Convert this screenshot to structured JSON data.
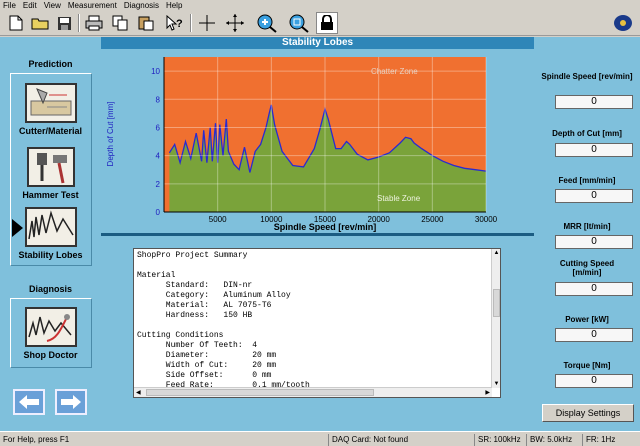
{
  "menu": [
    "File",
    "Edit",
    "View",
    "Measurement",
    "Diagnosis",
    "Help"
  ],
  "toolbar_icons": [
    "new-file-icon",
    "open-folder-icon",
    "save-icon",
    "print-icon",
    "copy-icon",
    "paste-icon",
    "context-help-icon",
    "crosshair-icon",
    "move-crosshair-icon",
    "zoom-in-icon",
    "zoom-fit-icon",
    "lock-icon",
    "app-logo-icon"
  ],
  "left": {
    "prediction_title": "Prediction",
    "cutter_label": "Cutter/Material",
    "hammer_label": "Hammer Test",
    "stability_label": "Stability Lobes",
    "diagnosis_title": "Diagnosis",
    "doctor_label": "Shop Doctor"
  },
  "chart": {
    "panel_title": "Stability Lobes",
    "chatter_label": "Chatter Zone",
    "stable_label": "Stable Zone"
  },
  "chart_data": {
    "type": "area",
    "title": "Stability Lobes",
    "xlabel": "Spindle Speed [rev/min]",
    "ylabel": "Depth of Cut [mm]",
    "xlim": [
      0,
      30000
    ],
    "ylim": [
      0,
      11
    ],
    "x_ticks": [
      5000,
      10000,
      15000,
      20000,
      25000,
      30000
    ],
    "y_ticks": [
      0,
      2,
      4,
      6,
      8,
      10
    ],
    "colors": {
      "chatter": "#f07030",
      "stable": "#7aa33a",
      "line": "#2a2ad0"
    },
    "x": [
      500,
      1000,
      1500,
      2000,
      2500,
      3000,
      3500,
      3700,
      4000,
      4300,
      4500,
      4800,
      5000,
      5200,
      5500,
      5800,
      6000,
      6500,
      7000,
      7500,
      8000,
      8500,
      9000,
      9500,
      9800,
      10000,
      10300,
      11000,
      12000,
      13000,
      14000,
      14500,
      15000,
      15300,
      16000,
      16500,
      17000,
      17300,
      18000,
      19000,
      20000,
      21000,
      22000,
      22500,
      23000,
      23300,
      24000,
      25000,
      26000,
      27000,
      28000,
      29000,
      30000
    ],
    "y": [
      4.2,
      4.8,
      3.5,
      5.0,
      3.8,
      5.6,
      3.6,
      5.8,
      3.5,
      6.0,
      3.6,
      6.3,
      3.5,
      6.2,
      4.0,
      6.6,
      4.3,
      3.4,
      3.0,
      4.6,
      2.8,
      4.3,
      4.8,
      6.0,
      7.0,
      7.6,
      6.2,
      4.3,
      3.3,
      3.2,
      4.5,
      5.8,
      7.3,
      6.6,
      4.5,
      4.5,
      5.0,
      4.8,
      4.1,
      3.7,
      3.9,
      4.2,
      4.9,
      5.3,
      5.2,
      4.9,
      4.5,
      4.0,
      3.6,
      3.3,
      3.1,
      3.0,
      2.9
    ]
  },
  "summary": {
    "lines": [
      "ShopPro Project Summary",
      "",
      "Material",
      "      Standard:   DIN-nr",
      "      Category:   Aluminum Alloy",
      "      Material:   AL 7075-T6",
      "      Hardness:   150 HB",
      "",
      "Cutting Conditions",
      "      Number Of Teeth:  4",
      "      Diameter:         20 mm",
      "      Width of Cut:     20 mm",
      "      Side Offset:      0 mm",
      "      Feed Rate:        0.1 mm/tooth"
    ]
  },
  "right": {
    "spindle_label": "Spindle Speed [rev/min]",
    "spindle_value": "0",
    "depth_label": "Depth of Cut [mm]",
    "depth_value": "0",
    "feed_label": "Feed [mm/min]",
    "feed_value": "0",
    "mrr_label": "MRR [lt/min]",
    "mrr_value": "0",
    "cutting_speed_label": "Cutting Speed [m/min]",
    "cutting_speed_value": "0",
    "power_label": "Power [kW]",
    "power_value": "0",
    "torque_label": "Torque [Nm]",
    "torque_value": "0",
    "display_settings": "Display Settings"
  },
  "status": {
    "help": "For Help, press F1",
    "daq": "DAQ Card: Not found",
    "sr": "SR: 100kHz",
    "bw": "BW: 5.0kHz",
    "fr": "FR: 1Hz"
  }
}
